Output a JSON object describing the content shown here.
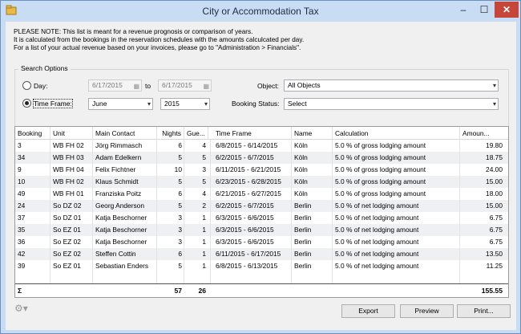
{
  "window": {
    "title": "City or Accommodation Tax",
    "min_glyph": "–",
    "max_glyph": "☐",
    "close_glyph": "✕"
  },
  "notice": {
    "line1": "PLEASE NOTE: This list is meant for a revenue prognosis or comparison of years.",
    "line2": "It is calculated from the bookings in the reservation schedules with the amounts calculcated per day.",
    "line3": "For a list of your actual revenue based on your invoices, please go to \"Administration > Financials\"."
  },
  "search": {
    "legend": "Search Options",
    "day_label": "Day:",
    "date_from": "6/17/2015",
    "to_label": "to",
    "date_to": "6/17/2015",
    "timeframe_label": "Time Frame:",
    "month": "June",
    "year": "2015",
    "object_label": "Object:",
    "object_value": "All Objects",
    "status_label": "Booking Status:",
    "status_value": "Select"
  },
  "table": {
    "headers": [
      "Booking",
      "Unit",
      "Main Contact",
      "Nights",
      "Gue...",
      "Time Frame",
      "Name",
      "Calculation",
      "Amoun..."
    ],
    "rows": [
      [
        "3",
        "WB FH 02",
        "Jörg Rimmasch",
        "6",
        "4",
        "6/8/2015 - 6/14/2015",
        "Köln",
        "5.0 % of gross lodging amount",
        "19.80"
      ],
      [
        "34",
        "WB FH 03",
        "Adam Edelkern",
        "5",
        "5",
        "6/2/2015 - 6/7/2015",
        "Köln",
        "5.0 % of gross lodging amount",
        "18.75"
      ],
      [
        "9",
        "WB FH 04",
        "Felix Fichtner",
        "10",
        "3",
        "6/11/2015 - 6/21/2015",
        "Köln",
        "5.0 % of gross lodging amount",
        "24.00"
      ],
      [
        "10",
        "WB FH 02",
        "Klaus Schmidt",
        "5",
        "5",
        "6/23/2015 - 6/28/2015",
        "Köln",
        "5.0 % of gross lodging amount",
        "15.00"
      ],
      [
        "49",
        "WB FH 01",
        "Franziska Poitz",
        "6",
        "4",
        "6/21/2015 - 6/27/2015",
        "Köln",
        "5.0 % of gross lodging amount",
        "18.00"
      ],
      [
        "24",
        "So DZ 02",
        "Georg Anderson",
        "5",
        "2",
        "6/2/2015 - 6/7/2015",
        "Berlin",
        "5.0 % of net lodging amount",
        "15.00"
      ],
      [
        "37",
        "So DZ 01",
        "Katja Beschorner",
        "3",
        "1",
        "6/3/2015 - 6/6/2015",
        "Berlin",
        "5.0 % of net lodging amount",
        "6.75"
      ],
      [
        "35",
        "So EZ 01",
        "Katja Beschorner",
        "3",
        "1",
        "6/3/2015 - 6/6/2015",
        "Berlin",
        "5.0 % of net lodging amount",
        "6.75"
      ],
      [
        "36",
        "So EZ 02",
        "Katja Beschorner",
        "3",
        "1",
        "6/3/2015 - 6/6/2015",
        "Berlin",
        "5.0 % of net lodging amount",
        "6.75"
      ],
      [
        "42",
        "So EZ 02",
        "Steffen Cottin",
        "6",
        "1",
        "6/11/2015 - 6/17/2015",
        "Berlin",
        "5.0 % of net lodging amount",
        "13.50"
      ],
      [
        "39",
        "So EZ 01",
        "Sebastian Enders",
        "5",
        "1",
        "6/8/2015 - 6/13/2015",
        "Berlin",
        "5.0 % of net lodging amount",
        "11.25"
      ]
    ],
    "totals": {
      "sigma": "Σ",
      "nights": "57",
      "guests": "26",
      "amount": "155.55"
    }
  },
  "buttons": {
    "export": "Export",
    "preview": "Preview",
    "print": "Print...",
    "gear_glyph": "⚙▾"
  },
  "colors": {
    "titlebar": "#c8dcf3",
    "close": "#c7463a",
    "row_alt": "#eef0f2"
  }
}
